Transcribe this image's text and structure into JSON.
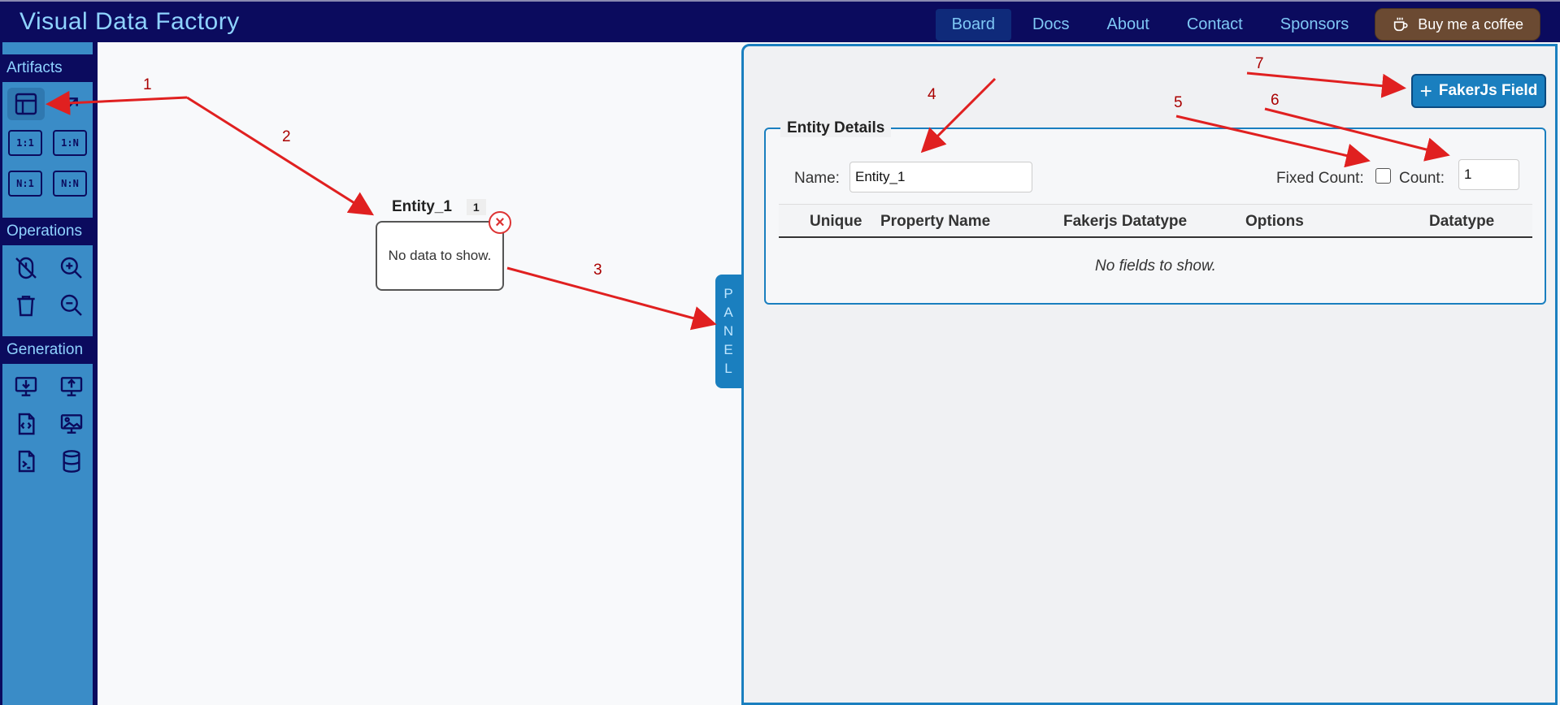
{
  "navbar": {
    "brand": "Visual Data Factory",
    "links": [
      "Board",
      "Docs",
      "About",
      "Contact",
      "Sponsors"
    ],
    "active": "Board",
    "coffee_label": "Buy me a coffee"
  },
  "sidebar": {
    "sections": {
      "artifacts": "Artifacts",
      "operations": "Operations",
      "generation": "Generation"
    },
    "relations": [
      "1:1",
      "1:N",
      "N:1",
      "N:N"
    ],
    "tools": {
      "artifacts": [
        "table-icon",
        "link-arrow-icon"
      ],
      "operations": [
        "mouse-off-icon",
        "zoom-in-icon",
        "trash-icon",
        "zoom-out-icon"
      ],
      "generation": [
        "download-monitor-icon",
        "upload-monitor-icon",
        "json-file-icon",
        "image-monitor-icon",
        "terminal-file-icon",
        "database-icon"
      ]
    }
  },
  "canvas": {
    "entity": {
      "name": "Entity_1",
      "count": "1",
      "empty_text": "No data to show."
    }
  },
  "panel": {
    "tab_letters": [
      "P",
      "A",
      "N",
      "E",
      "L"
    ],
    "add_button": "FakerJs Field",
    "details_legend": "Entity Details",
    "name_label": "Name:",
    "name_value": "Entity_1",
    "fixed_count_label": "Fixed Count:",
    "fixed_count_checked": false,
    "count_label": "Count:",
    "count_value": "1",
    "columns": [
      "Unique",
      "Property Name",
      "Fakerjs Datatype",
      "Options",
      "Datatype"
    ],
    "empty_text": "No fields to show."
  },
  "annotations": {
    "labels": [
      "1",
      "2",
      "3",
      "4",
      "5",
      "6",
      "7"
    ],
    "color": "#e02020"
  }
}
